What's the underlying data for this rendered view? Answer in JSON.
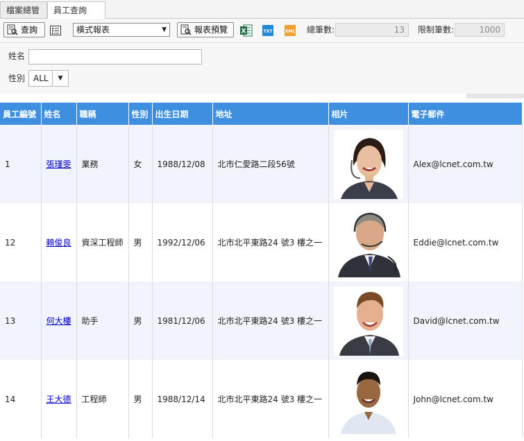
{
  "tabs": [
    {
      "label": "檔案總管"
    },
    {
      "label": "員工查詢"
    }
  ],
  "toolbar": {
    "query_label": "查詢",
    "report_type": "橫式報表",
    "preview_label": "報表預覽",
    "total_label": "總筆數:",
    "total_value": "13",
    "limit_label": "限制筆數:",
    "limit_value": "1000"
  },
  "filters": {
    "name_label": "姓名",
    "name_value": "",
    "gender_label": "性別",
    "gender_value": "ALL"
  },
  "grid": {
    "columns": [
      "員工編號",
      "姓名",
      "職稱",
      "性別",
      "出生日期",
      "地址",
      "相片",
      "電子郵件"
    ],
    "rows": [
      {
        "id": "1",
        "name": "張瑾雯",
        "title": "業務",
        "gender": "女",
        "birth": "1988/12/08",
        "address": "北市仁愛路二段56號",
        "email": "Alex@lcnet.com.tw"
      },
      {
        "id": "12",
        "name": "賴俊良",
        "title": "資深工程師",
        "gender": "男",
        "birth": "1992/12/06",
        "address": "北市北平東路24 號3 樓之一",
        "email": "Eddie@lcnet.com.tw"
      },
      {
        "id": "13",
        "name": "何大樓",
        "title": "助手",
        "gender": "男",
        "birth": "1981/12/06",
        "address": "北市北平東路24 號3 樓之一",
        "email": "David@lcnet.com.tw"
      },
      {
        "id": "14",
        "name": "王大德",
        "title": "工程師",
        "gender": "男",
        "birth": "1988/12/14",
        "address": "北市北平東路24 號3 樓之一",
        "email": "John@lcnet.com.tw"
      }
    ]
  },
  "colors": {
    "header_bg": "#3f8fe0",
    "row_alt_bg": "#f1f5fb",
    "link": "#0000cc"
  },
  "icons": [
    "search-report-icon",
    "list-icon",
    "preview-icon",
    "excel-icon",
    "txt-icon",
    "xml-icon",
    "close-icon",
    "chevron-down-icon"
  ]
}
